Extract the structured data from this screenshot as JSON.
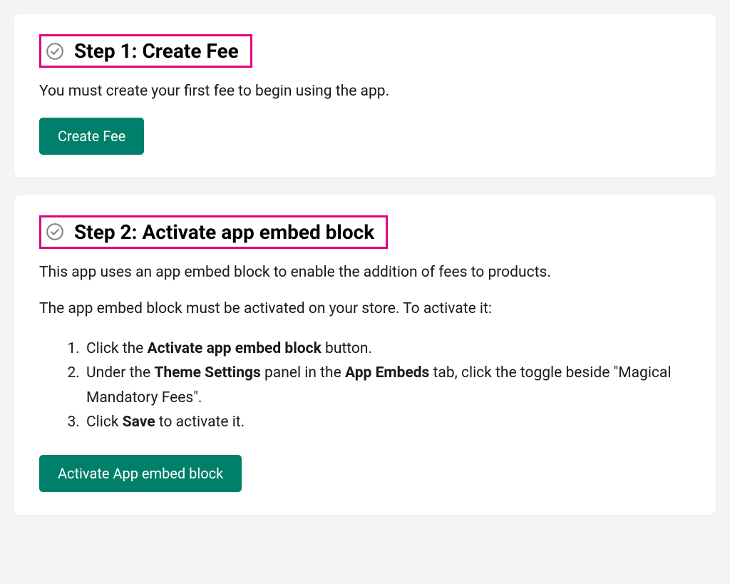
{
  "step1": {
    "title": "Step 1: Create Fee",
    "description": "You must create your first fee to begin using the app.",
    "button_label": "Create Fee"
  },
  "step2": {
    "title": "Step 2: Activate app embed block",
    "description1": "This app uses an app embed block to enable the addition of fees to products.",
    "description2": "The app embed block must be activated on your store. To activate it:",
    "instructions": {
      "item1_prefix": "Click the ",
      "item1_bold": "Activate app embed block",
      "item1_suffix": " button.",
      "item2_prefix": "Under the ",
      "item2_bold1": "Theme Settings",
      "item2_mid": " panel in the ",
      "item2_bold2": "App Embeds",
      "item2_suffix": " tab, click the toggle beside \"Magical Mandatory Fees\".",
      "item3_prefix": "Click ",
      "item3_bold": "Save",
      "item3_suffix": " to activate it."
    },
    "button_label": "Activate App embed block"
  },
  "colors": {
    "highlight_border": "#e6007e",
    "button_bg": "#00806a"
  }
}
